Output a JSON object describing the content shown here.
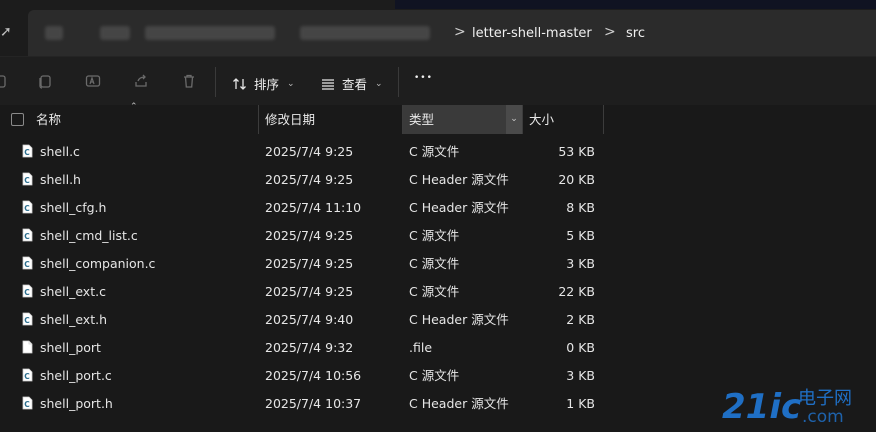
{
  "address_bar": {
    "back_glyph": "➚",
    "crumbs": [
      "letter-shell-master",
      "src"
    ],
    "separator": ">"
  },
  "toolbar": {
    "sort_label": "排序",
    "view_label": "查看",
    "more_label": "•••"
  },
  "columns": {
    "name": "名称",
    "modified": "修改日期",
    "type": "类型",
    "size": "大小"
  },
  "files": [
    {
      "name": "shell.c",
      "date": "2025/7/4 9:25",
      "type": "C 源文件",
      "size": "53 KB",
      "icon": "c-source-file-icon"
    },
    {
      "name": "shell.h",
      "date": "2025/7/4 9:25",
      "type": "C Header 源文件",
      "size": "20 KB",
      "icon": "c-source-file-icon"
    },
    {
      "name": "shell_cfg.h",
      "date": "2025/7/4 11:10",
      "type": "C Header 源文件",
      "size": "8 KB",
      "icon": "c-source-file-icon"
    },
    {
      "name": "shell_cmd_list.c",
      "date": "2025/7/4 9:25",
      "type": "C 源文件",
      "size": "5 KB",
      "icon": "c-source-file-icon"
    },
    {
      "name": "shell_companion.c",
      "date": "2025/7/4 9:25",
      "type": "C 源文件",
      "size": "3 KB",
      "icon": "c-source-file-icon"
    },
    {
      "name": "shell_ext.c",
      "date": "2025/7/4 9:25",
      "type": "C 源文件",
      "size": "22 KB",
      "icon": "c-source-file-icon"
    },
    {
      "name": "shell_ext.h",
      "date": "2025/7/4 9:40",
      "type": "C Header 源文件",
      "size": "2 KB",
      "icon": "c-source-file-icon"
    },
    {
      "name": "shell_port",
      "date": "2025/7/4 9:32",
      "type": ".file",
      "size": "0 KB",
      "icon": "blank-file-icon"
    },
    {
      "name": "shell_port.c",
      "date": "2025/7/4 10:56",
      "type": "C 源文件",
      "size": "3 KB",
      "icon": "c-source-file-icon"
    },
    {
      "name": "shell_port.h",
      "date": "2025/7/4 10:37",
      "type": "C Header 源文件",
      "size": "1 KB",
      "icon": "c-source-file-icon"
    }
  ],
  "watermark": {
    "text": "21ic",
    "sub": "电子网",
    "domain": ".com"
  },
  "colors": {
    "background": "#191919",
    "header_sorted": "#3a3a3a",
    "watermark_blue": "#1f6fc5"
  }
}
